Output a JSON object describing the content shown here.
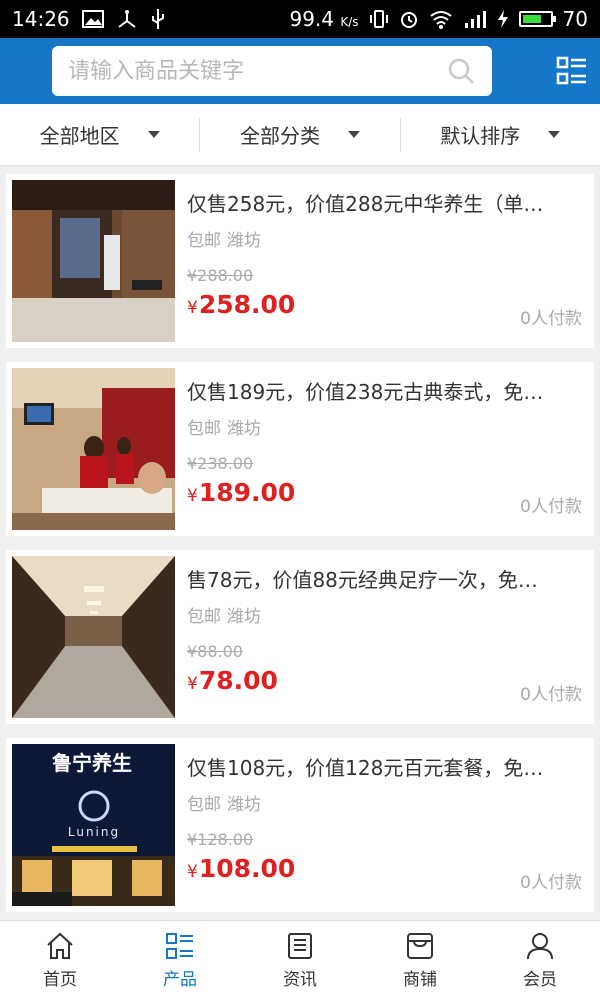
{
  "status_bar": {
    "time": "14:26",
    "speed": "99.4",
    "speed_unit": "K/s",
    "battery": "70",
    "battery_level": 0.7,
    "icons": [
      "image-icon",
      "usb-debug-icon",
      "usb-icon",
      "vibrate-icon",
      "alarm-icon",
      "wifi-icon",
      "signal-4g-icon",
      "charging-icon",
      "battery-icon"
    ]
  },
  "header": {
    "search_placeholder": "请输入商品关键字",
    "accent": "#1677c8"
  },
  "filters": [
    {
      "label": "全部地区"
    },
    {
      "label": "全部分类"
    },
    {
      "label": "默认排序"
    }
  ],
  "products": [
    {
      "title": "仅售258元，价值288元中华养生（单…",
      "tag": "包邮",
      "city": "潍坊",
      "old_price": "¥288.00",
      "currency": "¥",
      "price": "258.00",
      "paid": "0人付款"
    },
    {
      "title": "仅售189元，价值238元古典泰式，免…",
      "tag": "包邮",
      "city": "潍坊",
      "old_price": "¥238.00",
      "currency": "¥",
      "price": "189.00",
      "paid": "0人付款"
    },
    {
      "title": "售78元，价值88元经典足疗一次，免…",
      "tag": "包邮",
      "city": "潍坊",
      "old_price": "¥88.00",
      "currency": "¥",
      "price": "78.00",
      "paid": "0人付款"
    },
    {
      "title": "仅售108元，价值128元百元套餐，免…",
      "tag": "包邮",
      "city": "潍坊",
      "old_price": "¥128.00",
      "currency": "¥",
      "price": "108.00",
      "paid": "0人付款",
      "image_sign_text": "鲁宁养生",
      "image_logo_text": "Luning"
    }
  ],
  "tabbar": [
    {
      "label": "首页",
      "icon": "home-icon"
    },
    {
      "label": "产品",
      "icon": "product-grid-icon",
      "active": true
    },
    {
      "label": "资讯",
      "icon": "news-icon"
    },
    {
      "label": "商铺",
      "icon": "shop-icon"
    },
    {
      "label": "会员",
      "icon": "member-icon"
    }
  ],
  "colors": {
    "price": "#e02020",
    "active_tab": "#1677c8"
  }
}
